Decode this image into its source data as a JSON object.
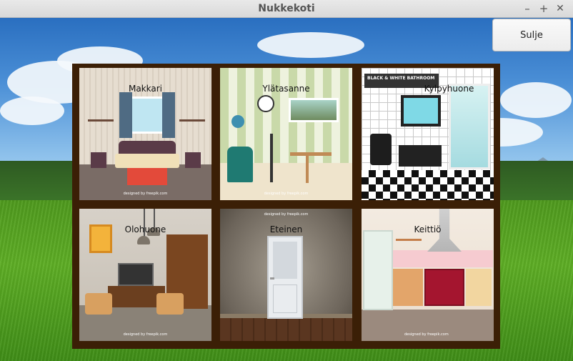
{
  "window": {
    "title": "Nukkekoti",
    "minimize": "–",
    "maximize": "+",
    "close": "✕"
  },
  "actions": {
    "close_label": "Sulje"
  },
  "rooms": [
    {
      "label": "Makkari",
      "credit": "designed by freepik.com"
    },
    {
      "label": "Ylätasanne",
      "credit": "designed by freepik.com"
    },
    {
      "label": "Kylpyhuone",
      "credit": "",
      "banner": "BLACK & WHITE BATHROOM"
    },
    {
      "label": "Olohuone",
      "credit": "designed by freepik.com"
    },
    {
      "label": "Eteinen",
      "credit": "designed by freepik.com"
    },
    {
      "label": "Keittiö",
      "credit": "designed by freepik.com"
    }
  ],
  "icons": {
    "minimize": "minimize-icon",
    "maximize": "maximize-icon",
    "close": "close-icon"
  },
  "colors": {
    "house_frame": "#3b1f06",
    "sky": "#4b8fd6",
    "grass": "#5eae25"
  }
}
